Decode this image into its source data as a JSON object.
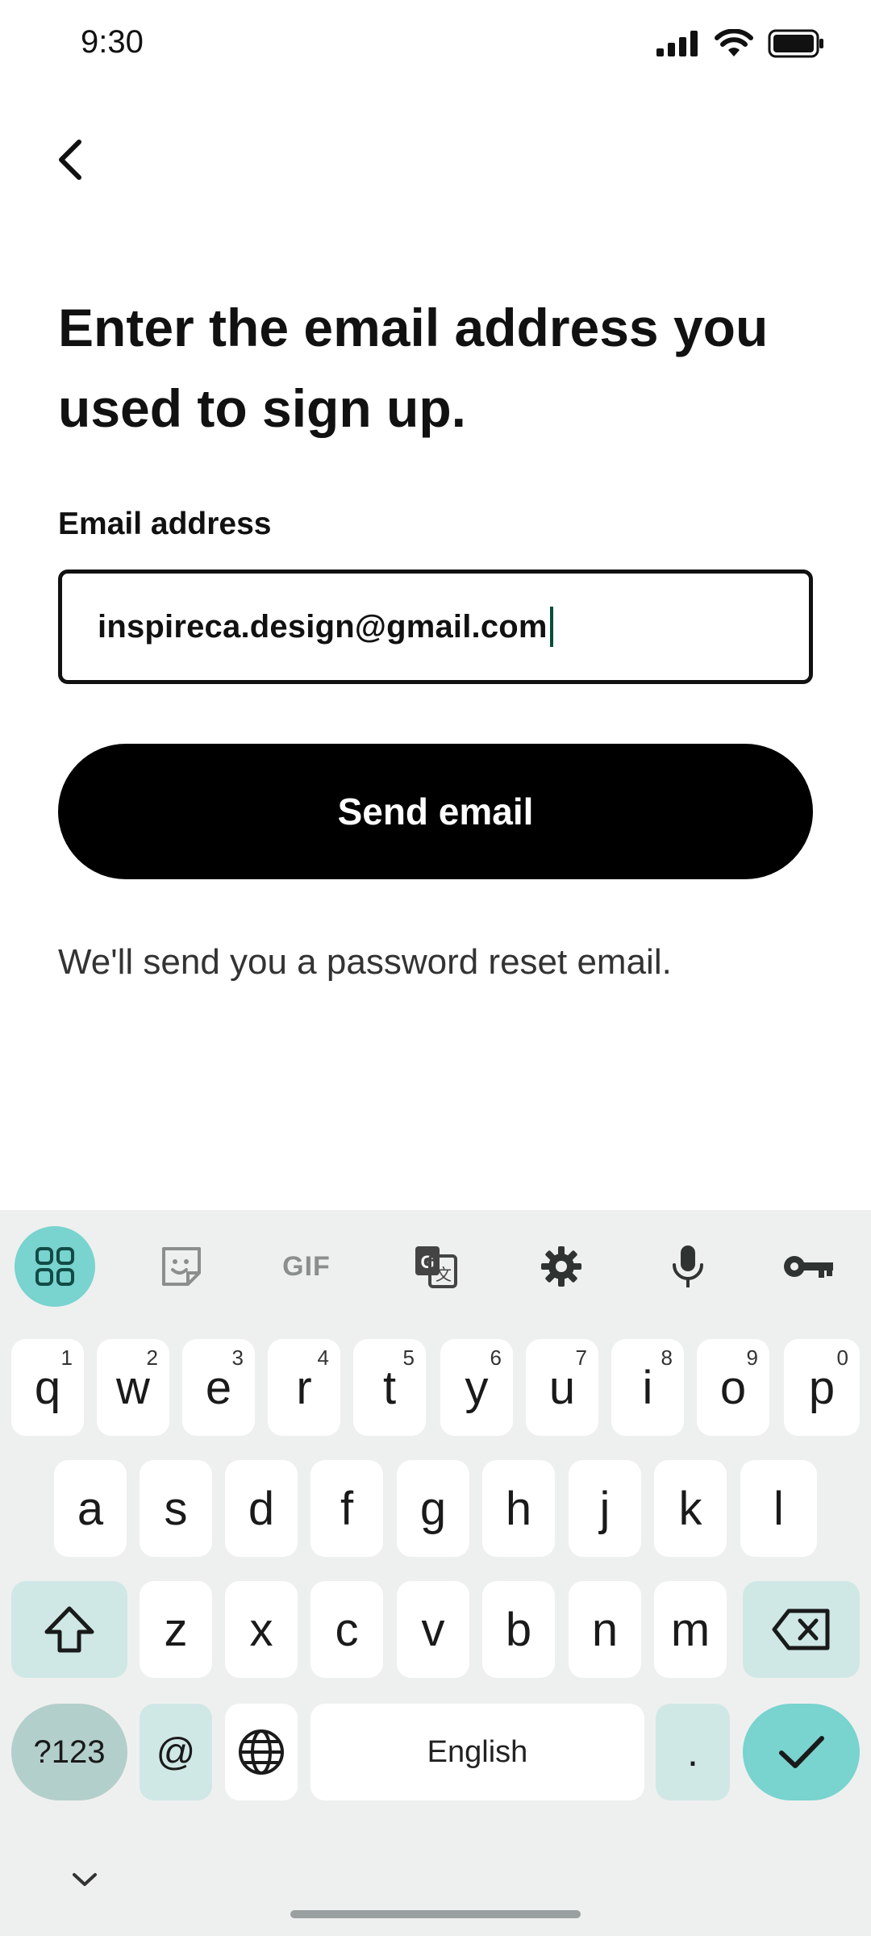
{
  "status": {
    "time": "9:30"
  },
  "page": {
    "heading": "Enter the email address you used to sign up.",
    "field_label": "Email address",
    "email_value": "inspireca.design@gmail.com",
    "send_button": "Send email",
    "helper_text": "We'll send you a password reset email."
  },
  "keyboard": {
    "toolbar": {
      "gif": "GIF"
    },
    "row1": [
      {
        "key": "q",
        "hint": "1"
      },
      {
        "key": "w",
        "hint": "2"
      },
      {
        "key": "e",
        "hint": "3"
      },
      {
        "key": "r",
        "hint": "4"
      },
      {
        "key": "t",
        "hint": "5"
      },
      {
        "key": "y",
        "hint": "6"
      },
      {
        "key": "u",
        "hint": "7"
      },
      {
        "key": "i",
        "hint": "8"
      },
      {
        "key": "o",
        "hint": "9"
      },
      {
        "key": "p",
        "hint": "0"
      }
    ],
    "row2": [
      "a",
      "s",
      "d",
      "f",
      "g",
      "h",
      "j",
      "k",
      "l"
    ],
    "row3": [
      "z",
      "x",
      "c",
      "v",
      "b",
      "n",
      "m"
    ],
    "row4": {
      "symbols": "?123",
      "at": "@",
      "space": "English",
      "period": "."
    }
  }
}
